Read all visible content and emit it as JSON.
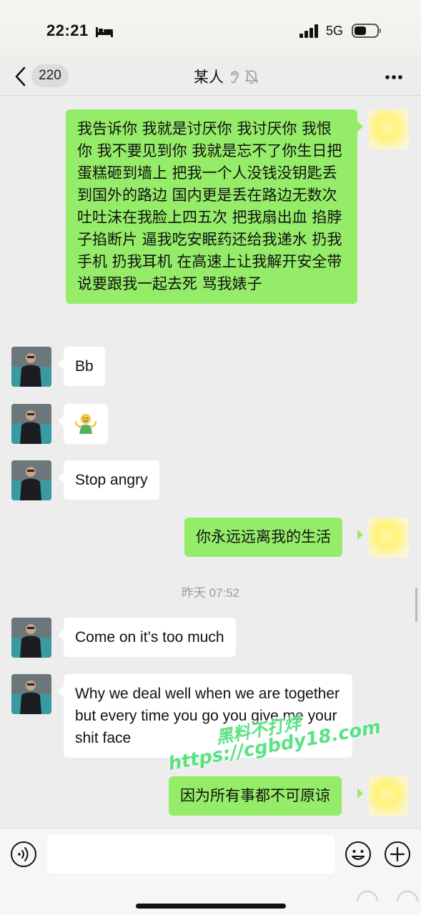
{
  "status_bar": {
    "time": "22:21",
    "network": "5G",
    "icons": [
      "bed-icon",
      "signal-icon",
      "battery-icon"
    ]
  },
  "nav": {
    "unread_count": "220",
    "title": "某人",
    "icons": [
      "back-icon",
      "ear-icon",
      "mute-icon",
      "more-icon"
    ]
  },
  "messages": [
    {
      "sender": "self",
      "type": "text",
      "text": "我告诉你 我就是讨厌你 我讨厌你 我恨你 我不要见到你  我就是忘不了你生日把蛋糕砸到墙上 把我一个人没钱没钥匙丢到国外的路边 国内更是丢在路边无数次 吐吐沫在我脸上四五次 把我扇出血 掐脖子掐断片 逼我吃安眠药还给我递水 扔我手机 扔我耳机 在高速上让我解开安全带说要跟我一起去死 骂我婊子"
    },
    {
      "sender": "friend",
      "type": "text",
      "text": "Bb"
    },
    {
      "sender": "friend",
      "type": "emoji",
      "text": "🤷",
      "icon": "shrug-emoji-icon"
    },
    {
      "sender": "friend",
      "type": "text",
      "text": "Stop angry"
    },
    {
      "sender": "self",
      "type": "text",
      "text": "你永远远离我的生活"
    },
    {
      "sender": "system",
      "type": "timestamp",
      "text": "昨天 07:52"
    },
    {
      "sender": "friend",
      "type": "text",
      "text": "Come on it’s too much"
    },
    {
      "sender": "friend",
      "type": "text",
      "text": "Why we deal well when we are together but every time you go you give me your shit face"
    },
    {
      "sender": "self",
      "type": "text",
      "text": "因为所有事都不可原谅"
    }
  ],
  "watermark": {
    "line1": "黑料不打烊",
    "line2": "https://cgbdy18.com"
  },
  "input_bar": {
    "placeholder": "",
    "icons": [
      "voice-icon",
      "emoji-icon",
      "plus-icon"
    ]
  },
  "colors": {
    "self_bubble": "#95ec69",
    "friend_bubble": "#ffffff",
    "background": "#ededed",
    "watermark": "#4de07a"
  }
}
